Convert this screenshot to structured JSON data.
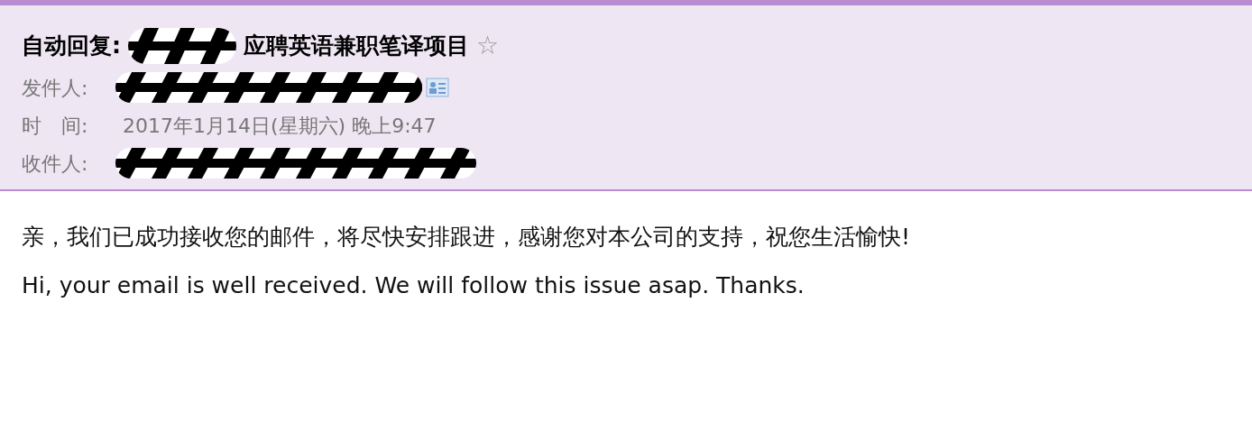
{
  "header": {
    "subject_prefix": "自动回复:",
    "subject": "应聘英语兼职笔译项目",
    "star": "☆",
    "starred": false,
    "fields": [
      {
        "kind": "sender",
        "label": "发件人:"
      },
      {
        "kind": "time",
        "label": "时　间:",
        "value": "2017年1月14日(星期六) 晚上9:47"
      },
      {
        "kind": "recipient",
        "label": "收件人:"
      }
    ]
  },
  "body": [
    "亲，我们已成功接收您的邮件，将尽快安排跟进，感谢您对本公司的支持，祝您生活愉快!",
    "Hi, your email is well received. We will follow this issue asap. Thanks."
  ]
}
